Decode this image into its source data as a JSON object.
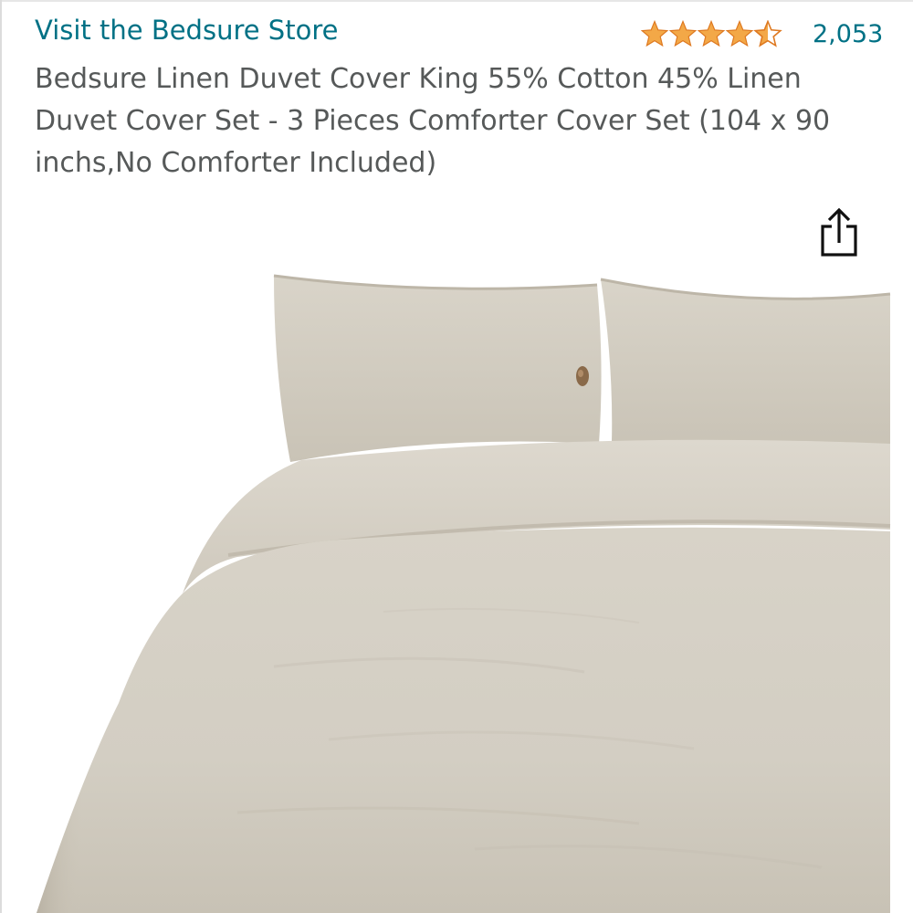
{
  "store": {
    "link_label": "Visit the Bedsure Store"
  },
  "rating": {
    "stars": 4.5,
    "max_stars": 5,
    "count": "2,053",
    "star_color": "#F3A847"
  },
  "product": {
    "title": "Bedsure Linen Duvet Cover King 55% Cotton 45% Linen Duvet Cover Set - 3 Pieces Comforter Cover Set (104 x 90 inchs,No Comforter Included)"
  },
  "icons": {
    "share": "share-icon"
  },
  "colors": {
    "link": "#007185",
    "title_text": "#565959",
    "fabric": "#D6D1C6"
  }
}
